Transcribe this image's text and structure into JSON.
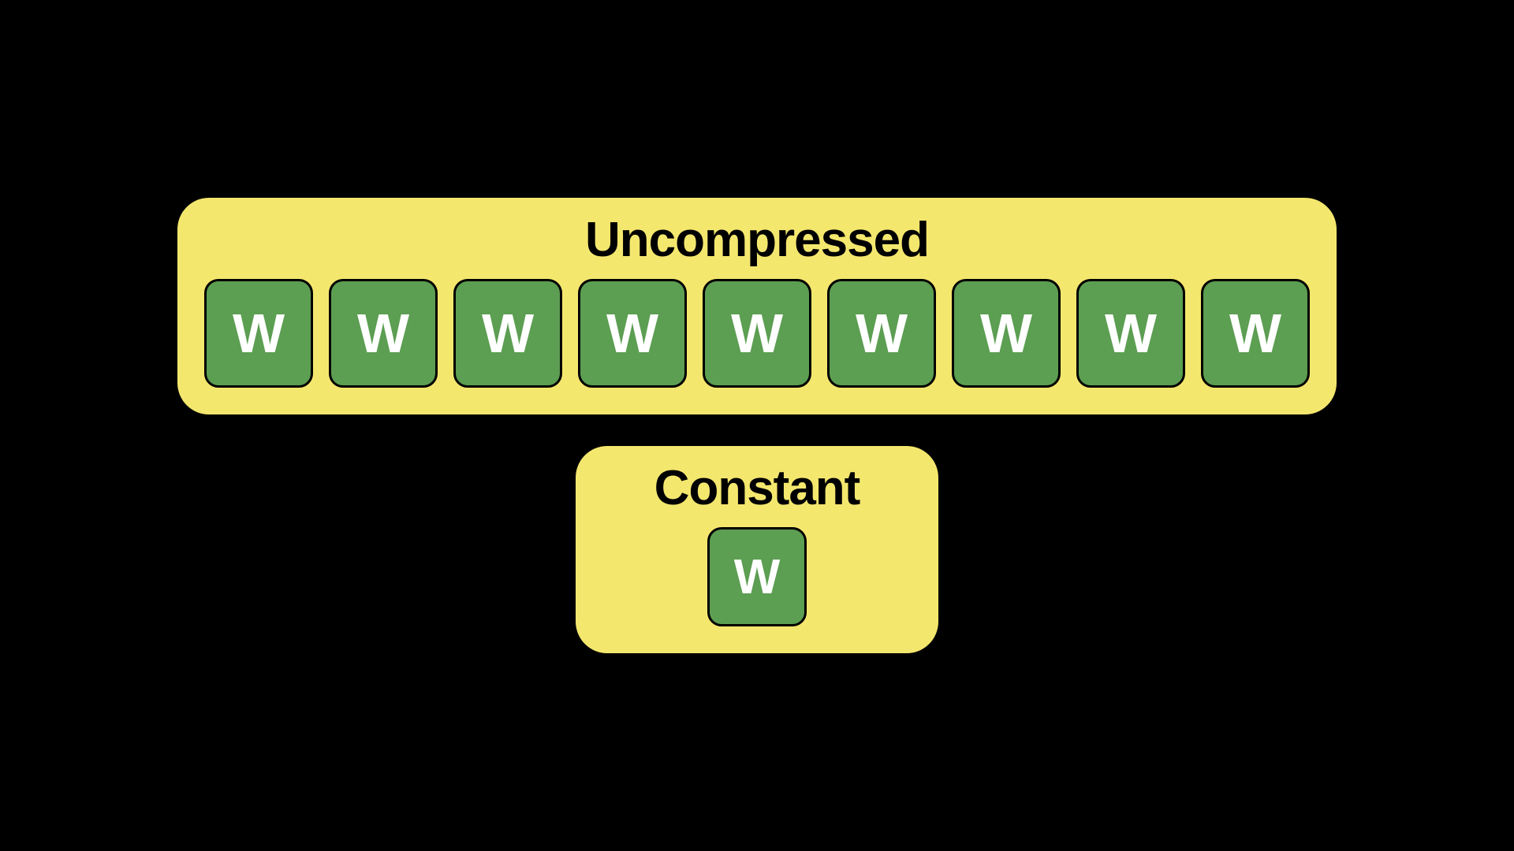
{
  "uncompressed": {
    "title": "Uncompressed",
    "tiles": [
      "W",
      "W",
      "W",
      "W",
      "W",
      "W",
      "W",
      "W",
      "W"
    ]
  },
  "constant": {
    "title": "Constant",
    "tiles": [
      "W"
    ]
  },
  "colors": {
    "panel_bg": "#F4E76E",
    "tile_bg": "#5C9E52",
    "tile_fg": "#FFFFFF",
    "background": "#000000"
  }
}
